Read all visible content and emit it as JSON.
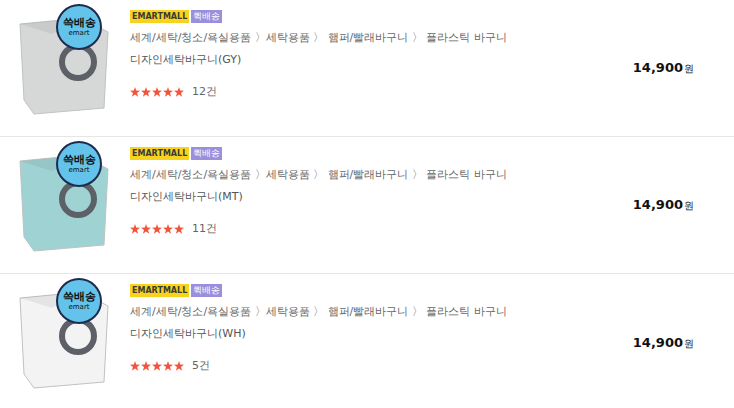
{
  "items": [
    {
      "logo_top": "쓱배송",
      "logo_bottom": "emart",
      "mall_tag": "EMARTMALL",
      "delivery_tag": "퀵배송",
      "category": "세계/세탁/청소/욕실용품 〉세탁용품 〉 햄퍼/빨래바구니 〉 플라스틱 바구니",
      "name": "디자인세탁바구니(GY)",
      "stars": 5,
      "reviews": "12건",
      "price": "14,900",
      "currency": "원",
      "color": "#d6d8d8"
    },
    {
      "logo_top": "쓱배송",
      "logo_bottom": "emart",
      "mall_tag": "EMARTMALL",
      "delivery_tag": "퀵배송",
      "category": "세계/세탁/청소/욕실용품 〉세탁용품 〉 햄퍼/빨래바구니 〉 플라스틱 바구니",
      "name": "디자인세탁바구니(MT)",
      "stars": 5,
      "reviews": "11건",
      "price": "14,900",
      "currency": "원",
      "color": "#9fd2d2"
    },
    {
      "logo_top": "쓱배송",
      "logo_bottom": "emart",
      "mall_tag": "EMARTMALL",
      "delivery_tag": "퀵배송",
      "category": "세계/세탁/청소/욕실용품 〉세탁용품 〉 햄퍼/빨래바구니 〉 플라스틱 바구니",
      "name": "디자인세탁바구니(WH)",
      "stars": 5,
      "reviews": "5건",
      "price": "14,900",
      "currency": "원",
      "color": "#f3f3f3"
    }
  ]
}
